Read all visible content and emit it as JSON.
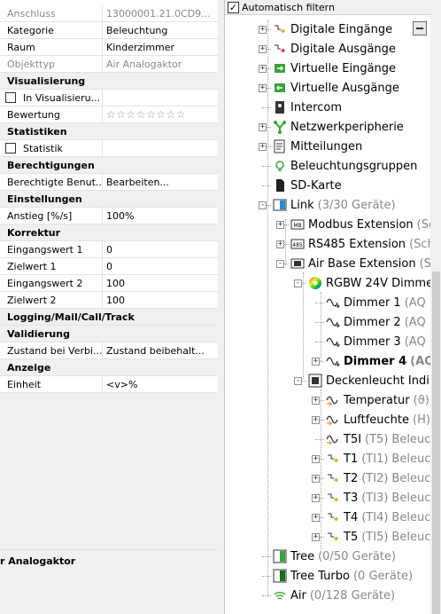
{
  "properties": {
    "rows": [
      {
        "type": "row",
        "key": "Anschluss",
        "value": "13000001.21.0CD9...",
        "readonly": true
      },
      {
        "type": "row",
        "key": "Kategorie",
        "value": "Beleuchtung"
      },
      {
        "type": "row",
        "key": "Raum",
        "value": "Kinderzimmer"
      },
      {
        "type": "row",
        "key": "Objekttyp",
        "value": "Air Analogaktor",
        "readonly": true
      },
      {
        "type": "cat",
        "key": "Visualisierung"
      },
      {
        "type": "check",
        "key": "In Visualisieru..."
      },
      {
        "type": "stars",
        "key": "Bewertung",
        "value": "☆☆☆☆☆☆☆☆"
      },
      {
        "type": "cat",
        "key": "Statistiken"
      },
      {
        "type": "check",
        "key": "Statistik"
      },
      {
        "type": "cat",
        "key": "Berechtigungen"
      },
      {
        "type": "row",
        "key": "Berechtigte Benut...",
        "value": "Bearbeiten..."
      },
      {
        "type": "cat",
        "key": "Einstellungen"
      },
      {
        "type": "row",
        "key": "Anstieg [%/s]",
        "value": "100%"
      },
      {
        "type": "cat",
        "key": "Korrektur"
      },
      {
        "type": "row",
        "key": "Eingangswert 1",
        "value": "0"
      },
      {
        "type": "row",
        "key": "Zielwert 1",
        "value": "0"
      },
      {
        "type": "row",
        "key": "Eingangswert 2",
        "value": "100"
      },
      {
        "type": "row",
        "key": "Zielwert 2",
        "value": "100"
      },
      {
        "type": "cat",
        "key": "Logging/Mail/Call/Track"
      },
      {
        "type": "cat",
        "key": "Validierung"
      },
      {
        "type": "row",
        "key": "Zustand bei Verbi...",
        "value": "Zustand beibehalt..."
      },
      {
        "type": "cat",
        "key": "Anzeige"
      },
      {
        "type": "row",
        "key": "Einheit",
        "value": "<v>%"
      }
    ],
    "description_title": "r Analogaktor"
  },
  "tree": {
    "filter_label": "Automatisch filtern",
    "filter_checked": "✓",
    "nodes": [
      {
        "label": "Digitale Eingänge",
        "icon": "digital-input-icon"
      },
      {
        "label": "Digitale Ausgänge",
        "icon": "digital-output-icon"
      },
      {
        "label": "Virtuelle Eingänge",
        "icon": "virtual-input-icon"
      },
      {
        "label": "Virtuelle Ausgänge",
        "icon": "virtual-output-icon"
      },
      {
        "label": "Intercom",
        "icon": "intercom-icon"
      },
      {
        "label": "Netzwerkperipherie",
        "icon": "network-icon"
      },
      {
        "label": "Mitteilungen",
        "icon": "messages-icon"
      },
      {
        "label": "Beleuchtungsgruppen",
        "icon": "lightgroup-icon"
      },
      {
        "label": "SD-Karte",
        "icon": "sdcard-icon"
      },
      {
        "label": "Link",
        "sub": "(3/30 Geräte)",
        "icon": "link-icon"
      },
      {
        "label": "Modbus Extension",
        "sub": "(Sc",
        "icon": "modbus-icon"
      },
      {
        "label": "RS485 Extension",
        "sub": "(Sch",
        "icon": "rs485-icon"
      },
      {
        "label": "Air Base Extension",
        "sub": "(Sc",
        "icon": "airbase-icon"
      },
      {
        "label": "RGBW 24V Dimme",
        "icon": "rgbw-icon"
      },
      {
        "label": "Dimmer 1",
        "sub": "(AQ",
        "icon": "analog-output-icon"
      },
      {
        "label": "Dimmer 2",
        "sub": "(AQ",
        "icon": "analog-output-icon"
      },
      {
        "label": "Dimmer 3",
        "sub": "(AQ",
        "icon": "analog-output-icon"
      },
      {
        "label": "Dimmer 4",
        "sub": "(AQ",
        "icon": "analog-output-icon"
      },
      {
        "label": "Deckenleucht Indi",
        "icon": "device-icon"
      },
      {
        "label": "Temperatur",
        "sub": "(ϑ)",
        "icon": "analog-input-icon"
      },
      {
        "label": "Luftfeuchte",
        "sub": "(H)",
        "icon": "analog-input-icon"
      },
      {
        "label": "T5I",
        "sub": "(T5)",
        "icon": "analog-input-icon"
      },
      {
        "label": "T1",
        "sub": "(TI1)",
        "icon": "digital-input-icon"
      },
      {
        "label": "T2",
        "sub": "(TI2)",
        "icon": "digital-input-icon"
      },
      {
        "label": "T3",
        "sub": "(TI3)",
        "icon": "digital-input-icon"
      },
      {
        "label": "T4",
        "sub": "(TI4)",
        "icon": "digital-input-icon"
      },
      {
        "label": "T5",
        "sub": "(TI5)",
        "icon": "digital-input-icon"
      },
      {
        "label": "Tree",
        "sub": "(0/50 Geräte)",
        "icon": "tree-icon"
      },
      {
        "label": "Tree Turbo",
        "sub": "(0 Geräte)",
        "icon": "tree-turbo-icon"
      },
      {
        "label": "Air",
        "sub": "(0/128 Geräte)",
        "icon": "air-icon"
      }
    ],
    "sub_beleuc": "Beleuc"
  },
  "colors": {
    "accent_green": "#3aa33a",
    "accent_orange": "#e8a22a",
    "accent_red": "#d23c3c",
    "link_blue": "#2a8ad2"
  }
}
